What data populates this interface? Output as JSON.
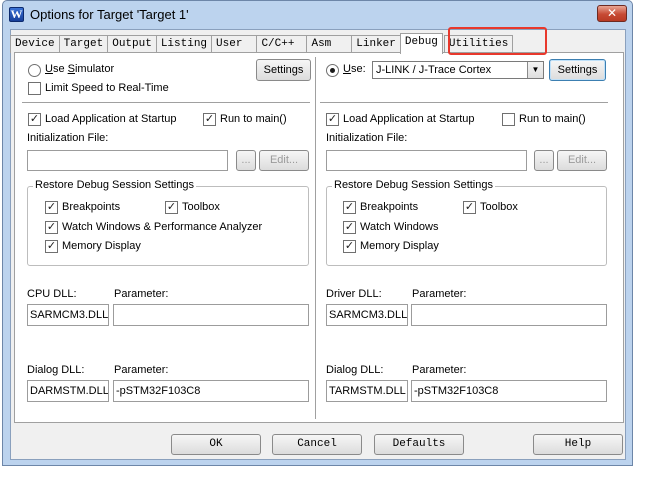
{
  "window": {
    "title": "Options for Target 'Target 1'",
    "icon": "uvision-w-icon",
    "close_glyph": "✕"
  },
  "tabs": [
    {
      "label": "Device"
    },
    {
      "label": "Target"
    },
    {
      "label": "Output"
    },
    {
      "label": "Listing"
    },
    {
      "label": "User"
    },
    {
      "label": "C/C++"
    },
    {
      "label": "Asm"
    },
    {
      "label": "Linker"
    },
    {
      "label": "Debug",
      "active": true
    },
    {
      "label": "Utilities",
      "highlighted": true
    }
  ],
  "left": {
    "use_simulator": "Use Simulator",
    "limit_speed": "Limit Speed to Real-Time",
    "settings": "Settings",
    "load_app": "Load Application at Startup",
    "run_to_main": "Run to main()",
    "init_file_label": "Initialization File:",
    "init_file_value": "",
    "browse": "...",
    "edit": "Edit...",
    "restore_title": "Restore Debug Session Settings",
    "breakpoints": "Breakpoints",
    "toolbox": "Toolbox",
    "watch": "Watch Windows & Performance Analyzer",
    "memory": "Memory Display",
    "dll_label": "CPU DLL:",
    "dll_param_label": "Parameter:",
    "dll_value": "SARMCM3.DLL",
    "dll_param_value": "",
    "dialog_label": "Dialog DLL:",
    "dialog_param_label": "Parameter:",
    "dialog_value": "DARMSTM.DLL",
    "dialog_param_value": "-pSTM32F103C8"
  },
  "right": {
    "use": "Use:",
    "driver": "J-LINK / J-Trace Cortex",
    "settings": "Settings",
    "load_app": "Load Application at Startup",
    "run_to_main": "Run to main()",
    "init_file_label": "Initialization File:",
    "init_file_value": "",
    "browse": "...",
    "edit": "Edit...",
    "restore_title": "Restore Debug Session Settings",
    "breakpoints": "Breakpoints",
    "toolbox": "Toolbox",
    "watch": "Watch Windows",
    "memory": "Memory Display",
    "dll_label": "Driver DLL:",
    "dll_param_label": "Parameter:",
    "dll_value": "SARMCM3.DLL",
    "dll_param_value": "",
    "dialog_label": "Dialog DLL:",
    "dialog_param_label": "Parameter:",
    "dialog_value": "TARMSTM.DLL",
    "dialog_param_value": "-pSTM32F103C8"
  },
  "footer": {
    "ok": "OK",
    "cancel": "Cancel",
    "defaults": "Defaults",
    "help": "Help"
  },
  "state": {
    "left_use_simulator": false,
    "left_limit_speed": false,
    "left_load_app": true,
    "left_run_to_main": true,
    "left_breakpoints": true,
    "left_toolbox": true,
    "left_watch": true,
    "left_memory": true,
    "right_use": true,
    "right_load_app": true,
    "right_run_to_main": false,
    "right_breakpoints": true,
    "right_toolbox": true,
    "right_watch": true,
    "right_memory": true
  }
}
